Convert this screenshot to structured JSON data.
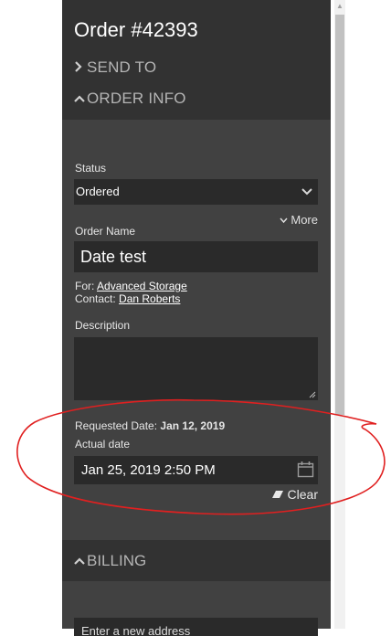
{
  "order": {
    "title": "Order #42393",
    "send_to": "SEND TO",
    "order_info": "ORDER INFO"
  },
  "form": {
    "status_label": "Status",
    "status_value": "Ordered",
    "more_label": "More",
    "order_name_label": "Order Name",
    "order_name_value": "Date test",
    "for_label": "For:",
    "for_link": "Advanced Storage",
    "contact_label": "Contact:",
    "contact_link": "Dan Roberts",
    "description_label": "Description",
    "description_value": "",
    "requested_label": "Requested Date:",
    "requested_value": "Jan 12, 2019",
    "actual_label": "Actual date",
    "actual_value": "Jan 25, 2019  2:50 PM",
    "clear_label": "Clear"
  },
  "billing": {
    "title": "BILLING",
    "address_placeholder": "Enter a new address"
  },
  "colors": {
    "panel": "#414141",
    "header": "#323232",
    "field": "#2a2a2a",
    "annotation": "#e02020"
  },
  "icons": {
    "send_to": "chevron-right-icon",
    "order_info": "chevron-up-icon",
    "billing": "chevron-up-icon",
    "select": "chevron-down-icon",
    "more": "chevron-down-icon",
    "calendar": "calendar-icon",
    "clear": "eraser-icon"
  }
}
